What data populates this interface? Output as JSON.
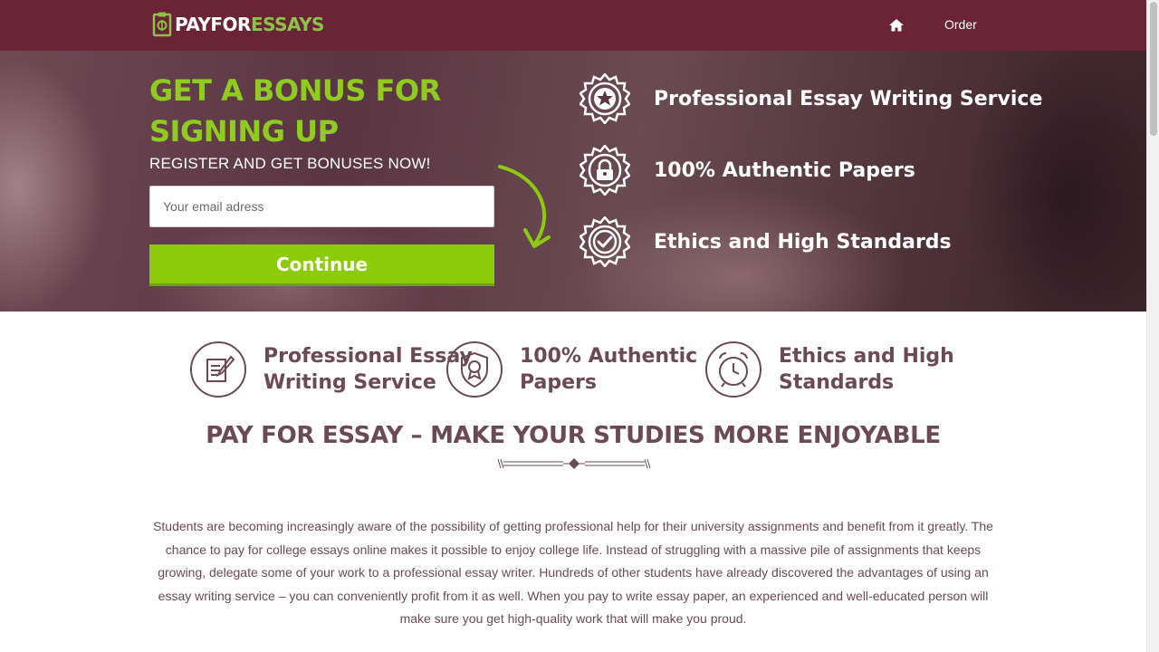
{
  "header": {
    "logo": {
      "part1": "PAYFOR",
      "part2": "ESSAYS"
    },
    "nav": {
      "home_icon": "home-icon",
      "order_label": "Order"
    }
  },
  "hero": {
    "title": "GET A BONUS FOR SIGNING UP",
    "subtitle": "REGISTER AND GET BONUSES NOW!",
    "email_placeholder": "Your email adress",
    "button_label": "Continue",
    "features": [
      {
        "label": "Professional Essay Writing Service",
        "icon": "star-badge-icon"
      },
      {
        "label": "100% Authentic Papers",
        "icon": "lock-badge-icon"
      },
      {
        "label": "Ethics and High Standards",
        "icon": "check-badge-icon"
      }
    ]
  },
  "benefits": [
    {
      "line1": "Professional Essay",
      "line2": "Writing Service",
      "icon": "document-pen-icon"
    },
    {
      "line1": "100% Authentic",
      "line2": "Papers",
      "icon": "shield-award-icon"
    },
    {
      "line1": "Ethics and High",
      "line2": "Standards",
      "icon": "alarm-clock-icon"
    }
  ],
  "section": {
    "title": "PAY FOR ESSAY – MAKE YOUR STUDIES MORE ENJOYABLE",
    "body": "Students are becoming increasingly aware of the possibility of getting professional help for their university assignments and benefit from it greatly. The chance to pay for college essays online makes it possible to enjoy college life. Instead of struggling with a massive pile of assignments that keeps growing, delegate some of your work to a professional essay writer. Hundreds of other students have already discovered the advantages of using an essay writing service – you can conveniently profit from it as well. When you pay to write essay paper, an experienced and well-educated person will make sure you get high-quality work that will make you proud."
  },
  "colors": {
    "header_bg": "#6b2336",
    "accent_green": "#8dcb0a",
    "text_maroon": "#6b4a56"
  }
}
